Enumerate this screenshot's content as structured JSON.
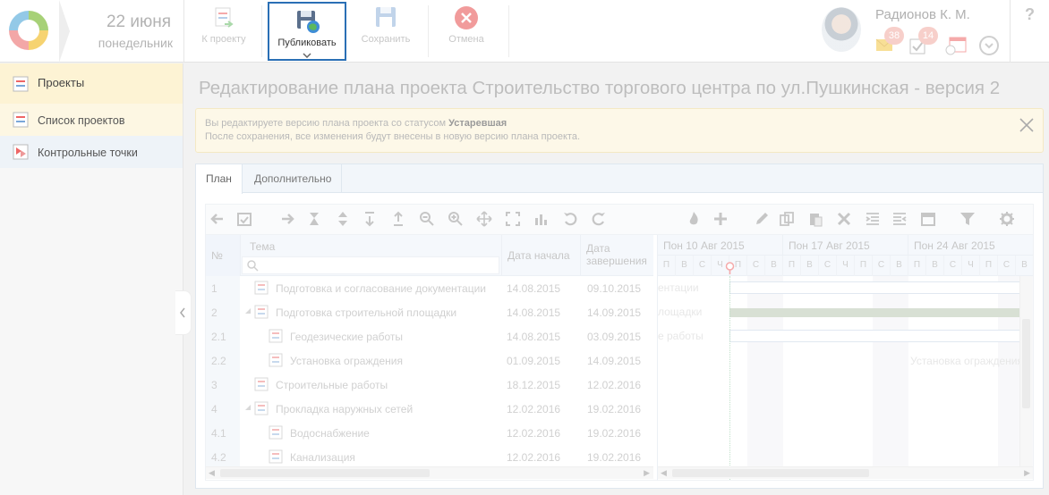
{
  "header": {
    "date_day": "22 июня",
    "date_weekday": "понедельник",
    "toolbar": {
      "to_project": "К проекту",
      "publish": "Публиковать",
      "save": "Сохранить",
      "cancel": "Отмена"
    },
    "user_name": "Радионов К. М.",
    "mail_count": "38",
    "tasks_count": "14",
    "help": "?"
  },
  "sidebar": {
    "section": "Проекты",
    "items": [
      {
        "label": "Список проектов"
      },
      {
        "label": "Контрольные точки"
      }
    ]
  },
  "page": {
    "title": "Редактирование плана проекта Строительство торгового центра по ул.Пушкинская - версия 2",
    "warning_line1_prefix": "Вы редактируете версию плана проекта со статусом ",
    "warning_status": "Устаревшая",
    "warning_line2": "После сохранения, все изменения будут внесены в новую версию плана проекта."
  },
  "tabs": [
    {
      "label": "План"
    },
    {
      "label": "Дополнительно"
    }
  ],
  "grid": {
    "columns": {
      "num": "№",
      "topic": "Тема",
      "start": "Дата начала",
      "end_line1": "Дата",
      "end_line2": "завершения"
    },
    "rows": [
      {
        "num": "1",
        "name": "Подготовка и согласование документации",
        "start": "14.08.2015",
        "end": "09.10.2015",
        "level": 0,
        "group": false
      },
      {
        "num": "2",
        "name": "Подготовка строительной площадки",
        "start": "14.08.2015",
        "end": "14.09.2015",
        "level": 0,
        "group": true
      },
      {
        "num": "2.1",
        "name": "Геодезические работы",
        "start": "14.08.2015",
        "end": "03.09.2015",
        "level": 1,
        "group": false
      },
      {
        "num": "2.2",
        "name": "Установка ограждения",
        "start": "01.09.2015",
        "end": "14.09.2015",
        "level": 1,
        "group": false
      },
      {
        "num": "3",
        "name": "Строительные работы",
        "start": "18.12.2015",
        "end": "12.02.2016",
        "level": 0,
        "group": false
      },
      {
        "num": "4",
        "name": "Прокладка наружных сетей",
        "start": "12.02.2016",
        "end": "19.02.2016",
        "level": 0,
        "group": true
      },
      {
        "num": "4.1",
        "name": "Водоснабжение",
        "start": "12.02.2016",
        "end": "19.02.2016",
        "level": 1,
        "group": false
      },
      {
        "num": "4.2",
        "name": "Канализация",
        "start": "12.02.2016",
        "end": "19.02.2016",
        "level": 1,
        "group": false
      }
    ]
  },
  "chart": {
    "weeks": [
      "Пон 10 Авг 2015",
      "Пон 17 Авг 2015",
      "Пон 24 Авг 2015"
    ],
    "days": [
      "П",
      "В",
      "С",
      "Ч",
      "П",
      "С",
      "В"
    ],
    "labels": {
      "row1": "ентации",
      "row2": "лощадки",
      "row3": "е работы",
      "row4": "Установка ограждения"
    }
  },
  "colors": {
    "accent_border": "#2a6fb5",
    "badge": "#f2a9a0",
    "warning_bg": "#fdf8e8",
    "summary_bar": "#b9c7b1"
  }
}
